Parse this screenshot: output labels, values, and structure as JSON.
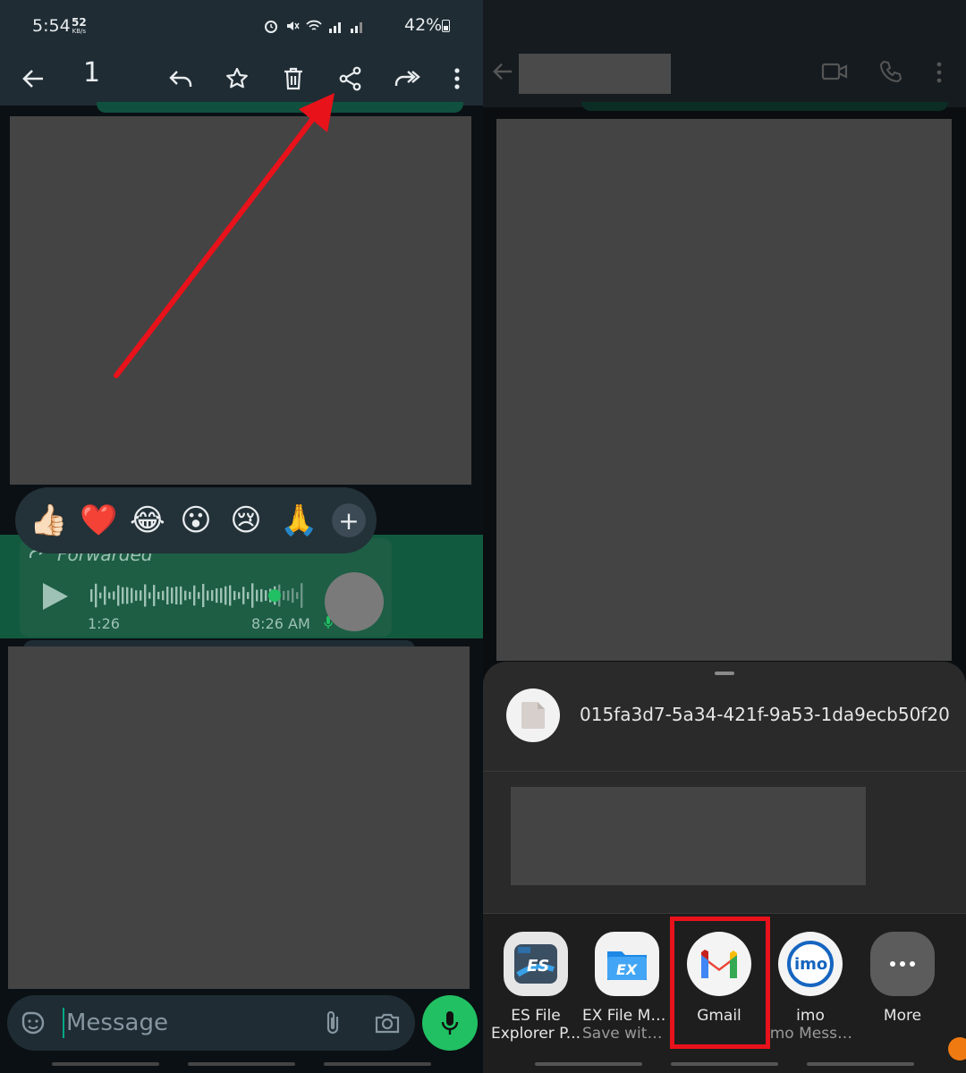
{
  "status_bar": {
    "time": "5:54",
    "net_speed": "52",
    "net_unit": "KB/s",
    "battery": "42%"
  },
  "selection_bar": {
    "count": "1"
  },
  "reactions": {
    "emojis": [
      "👍🏻",
      "❤️",
      "😂",
      "😮",
      "😢",
      "🙏"
    ],
    "more": "+"
  },
  "voice_message": {
    "label": "Forwarded",
    "duration": "1:26",
    "time": "8:26 AM"
  },
  "composer": {
    "placeholder": "Message"
  },
  "share_sheet": {
    "file_name": "015fa3d7-5a34-421f-9a53-1da9ecb50f20",
    "apps": [
      {
        "name": "ES File",
        "sub": "Explorer P...",
        "icon": "es-file-explorer-icon"
      },
      {
        "name": "EX File Ma...",
        "sub": "Save with ...",
        "icon": "ex-file-manager-icon"
      },
      {
        "name": "Gmail",
        "sub": "",
        "icon": "gmail-icon"
      },
      {
        "name": "imo",
        "sub": "imo Messe...",
        "icon": "imo-icon"
      },
      {
        "name": "More",
        "sub": "",
        "icon": "more-icon"
      }
    ]
  },
  "colors": {
    "whatsapp_green": "#21c063",
    "annotation_red": "#e8121b",
    "bar": "#1f2c34"
  }
}
